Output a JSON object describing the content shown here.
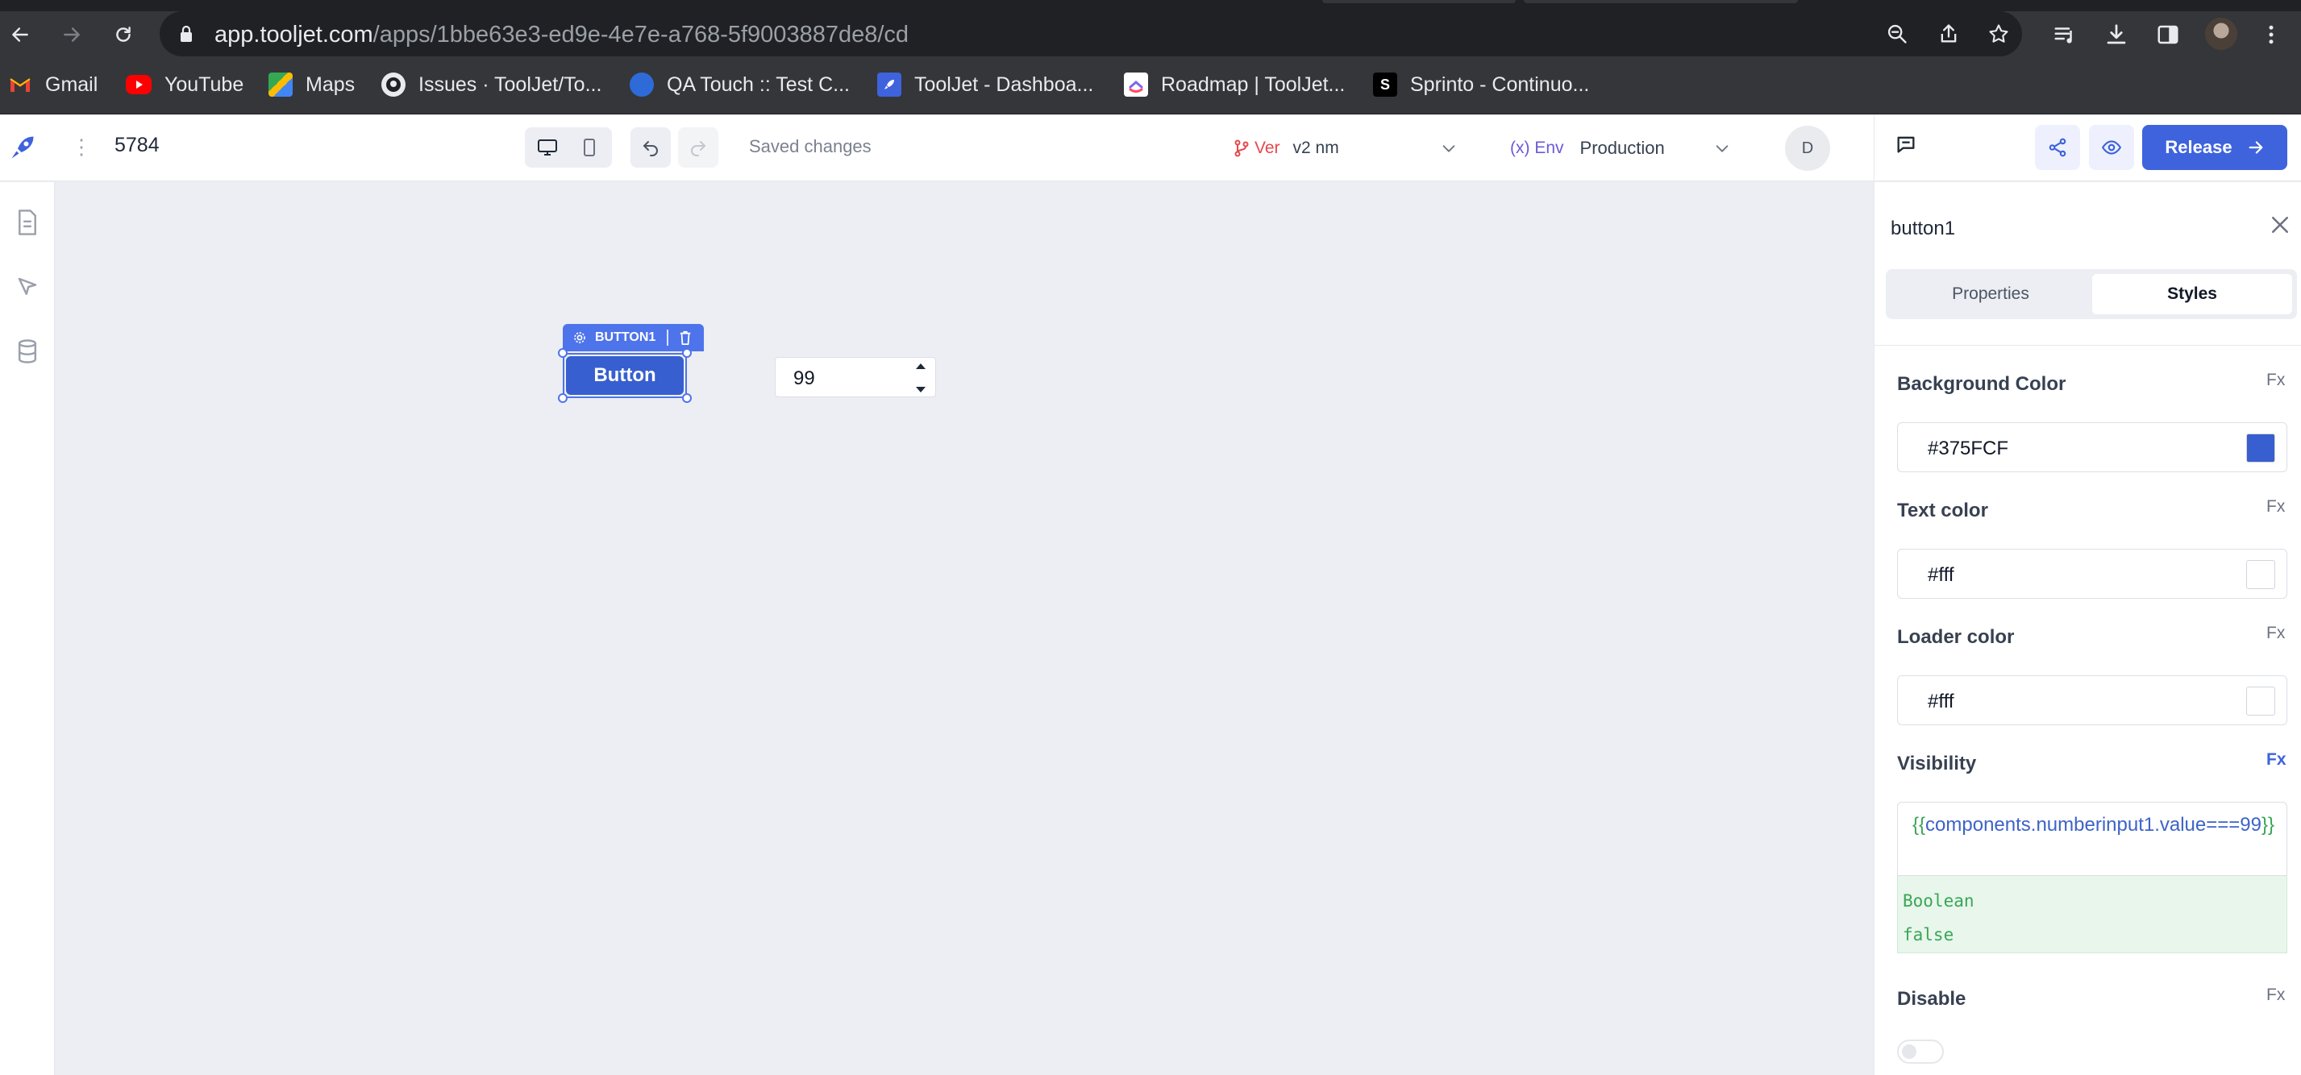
{
  "browser": {
    "url_domain": "app.tooljet.com",
    "url_path": "/apps/1bbe63e3-ed9e-4e7e-a768-5f9003887de8/cd",
    "bookmarks": [
      {
        "label": "Gmail",
        "icon": "gmail-icon"
      },
      {
        "label": "YouTube",
        "icon": "youtube-icon"
      },
      {
        "label": "Maps",
        "icon": "maps-icon"
      },
      {
        "label": "Issues · ToolJet/To...",
        "icon": "github-icon"
      },
      {
        "label": "QA Touch :: Test C...",
        "icon": "qatouch-icon"
      },
      {
        "label": "ToolJet - Dashboa...",
        "icon": "tooljet-icon"
      },
      {
        "label": "Roadmap | ToolJet...",
        "icon": "clickup-icon"
      },
      {
        "label": "Sprinto - Continuo...",
        "icon": "sprinto-icon"
      }
    ]
  },
  "header": {
    "app_name": "5784",
    "saved_status": "Saved changes",
    "version_label": "Ver",
    "version_value": "v2 nm",
    "env_label": "(x) Env",
    "env_value": "Production",
    "user_initial": "D",
    "release_label": "Release"
  },
  "canvas": {
    "widget_tag": "BUTTON1",
    "button_text": "Button",
    "number_input_value": "99"
  },
  "inspector": {
    "component_name": "button1",
    "tabs": [
      "Properties",
      "Styles"
    ],
    "active_tab": "Styles",
    "fx_label": "Fx",
    "background_color": {
      "label": "Background Color",
      "value": "#375FCF",
      "swatch": "#375FCF"
    },
    "text_color": {
      "label": "Text color",
      "value": "#fff",
      "swatch": "#ffffff"
    },
    "loader_color": {
      "label": "Loader color",
      "value": "#fff",
      "swatch": "#ffffff"
    },
    "visibility": {
      "label": "Visibility",
      "brace_open": "{{",
      "expression": "components.numberinput1.value===99",
      "brace_close": "}}",
      "preview_type": "Boolean",
      "preview_value": "false"
    },
    "disable": {
      "label": "Disable",
      "enabled": false
    }
  },
  "colors": {
    "accent": "#3e63dd",
    "canvas_bg": "#eceef3",
    "button_bg": "#375fcf"
  }
}
